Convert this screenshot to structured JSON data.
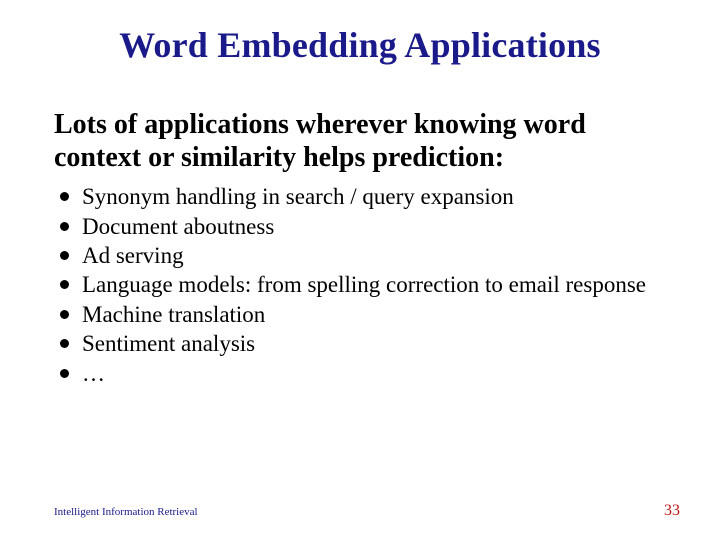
{
  "title": "Word Embedding Applications",
  "intro": "Lots of applications wherever knowing word context or similarity helps prediction:",
  "bullets": [
    "Synonym handling in search / query expansion",
    "Document aboutness",
    "Ad serving",
    "Language models: from spelling correction to email response",
    "Machine translation",
    "Sentiment analysis",
    "…"
  ],
  "footer": {
    "left": "Intelligent Information Retrieval",
    "page": "33"
  }
}
